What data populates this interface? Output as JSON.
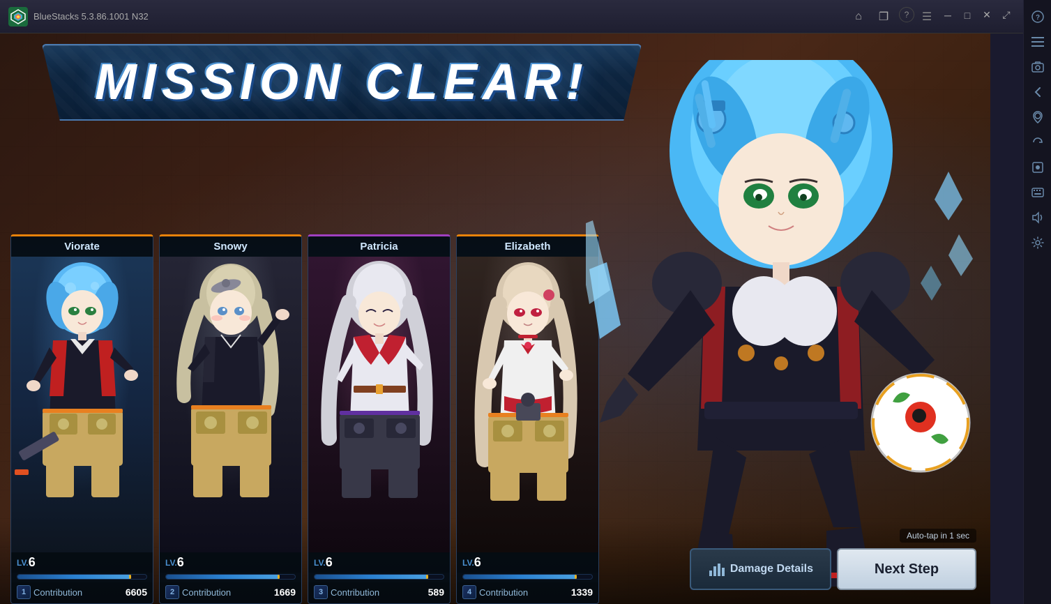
{
  "app": {
    "title": "BlueStacks 5.3.86.1001 N32",
    "logo": "BS"
  },
  "titlebar": {
    "home_label": "⌂",
    "copy_label": "❐",
    "help_label": "?",
    "menu_label": "☰",
    "minimize_label": "─",
    "maximize_label": "□",
    "close_label": "✕",
    "stretch_label": "⤢"
  },
  "mission": {
    "title": "MISSION CLEAR!"
  },
  "characters": [
    {
      "id": "viorate",
      "name": "Viorate",
      "level": "LV.",
      "level_num": "6",
      "xp_percent": 88,
      "card_border": "orange",
      "rank": "1",
      "contribution_label": "Contribution",
      "contribution_value": "6605",
      "hair_color": "#6ac0f8"
    },
    {
      "id": "snowy",
      "name": "Snowy",
      "level": "LV.",
      "level_num": "6",
      "xp_percent": 88,
      "card_border": "orange",
      "rank": "2",
      "contribution_label": "Contribution",
      "contribution_value": "1669",
      "hair_color": "#c8c0a8"
    },
    {
      "id": "patricia",
      "name": "Patricia",
      "level": "LV.",
      "level_num": "6",
      "xp_percent": 88,
      "card_border": "purple",
      "rank": "3",
      "contribution_label": "Contribution",
      "contribution_value": "589",
      "hair_color": "#e0e0e8"
    },
    {
      "id": "elizabeth",
      "name": "Elizabeth",
      "level": "LV.",
      "level_num": "6",
      "xp_percent": 88,
      "card_border": "orange",
      "rank": "4",
      "contribution_label": "Contribution",
      "contribution_value": "1339",
      "hair_color": "#d8c8b8"
    }
  ],
  "buttons": {
    "damage_details_label": "Damage Details",
    "next_step_label": "Next Step",
    "autotap_label": "Auto-tap in 1 sec"
  },
  "sidebar_tools": [
    "?",
    "☰",
    "⊞",
    "↩",
    "⊙",
    "⧉",
    "⟳",
    "⊕",
    "⊞",
    "⊙"
  ]
}
